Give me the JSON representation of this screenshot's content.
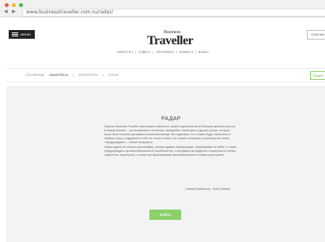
{
  "browser": {
    "nav_arrows": "◀ ▶",
    "url": "www.businesstraveller.com.ru/radar/"
  },
  "header": {
    "menu_label": "МЕНЮ",
    "logo_small": "Business",
    "logo": "Traveller",
    "search_label": "ПОИСКИ",
    "topnav": [
      "НОВОСТИ ▾",
      "|",
      "ОТДЫХ ▾",
      "|",
      "ПОНОРАМА ▾",
      "|",
      "БИЗНЕС ▾",
      "|",
      "ВИЗЫ ▾"
    ]
  },
  "subnav": {
    "items": [
      "ГОСТИНИЦЫ",
      "АВИАРЕЙСЫ",
      "|",
      "АЭРОПОРТЫ",
      "|",
      "ОТЕЛИ"
    ],
    "radar_label": "РАДАР"
  },
  "main": {
    "title": "РАДАР",
    "paragraph1": "Журнал Business Traveller приглашает известных тревел-журналистов и блогеров принять участие в новом проекте – протестировать гостиницы, авиарейсы, аэропорты и другие услуги, которые могут быть полезны деловым путешественникам. Мы надеемся, что отзывы будут написаны от первого лица и содержать в себе не только плюсы, но и какие-то минусы, поскольку мы хотим «предупредить» – значит вооружить.",
    "paragraph2": "Наша задача не столько критиковать, сколько давать информацию, «примеривая на себя», а также предупреждать путешественников об особенностях, с которыми им придется столкнуться в отелях, самолетах, аэропортах, а также при бронировании автомобилей или столика в ресторане.",
    "editor": "Главный редактор - Анна Сенкер",
    "login_label": "ВОЙТИ"
  },
  "colors": {
    "accent_green": "#8bd06a",
    "menu_bg": "#222222"
  }
}
